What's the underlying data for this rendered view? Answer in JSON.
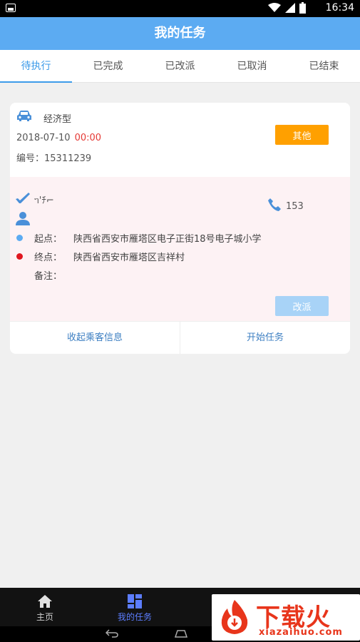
{
  "status_bar": {
    "time": "16:34"
  },
  "header": {
    "title": "我的任务"
  },
  "tabs": [
    {
      "label": "待执行",
      "active": true
    },
    {
      "label": "已完成",
      "active": false
    },
    {
      "label": "已改派",
      "active": false
    },
    {
      "label": "已取消",
      "active": false
    },
    {
      "label": "已结束",
      "active": false
    }
  ],
  "order": {
    "car_type": "经济型",
    "date": "2018-07-10",
    "time": "00:00",
    "order_no_label": "编号：",
    "order_no": "15311239",
    "other_button": "其他",
    "flight": "ᥐ'ﾁ⌐",
    "phone": "153",
    "origin_label": "起点：",
    "origin": "陕西省西安市雁塔区电子正街18号电子城小学",
    "destination_label": "终点：",
    "destination": "陕西省西安市雁塔区吉祥村",
    "remark_label": "备注：",
    "remark": "",
    "reassign_button": "改派",
    "collapse_action": "收起乘客信息",
    "start_action": "开始任务"
  },
  "bottom_nav": [
    {
      "label": "主页",
      "icon": "home-icon",
      "active": false
    },
    {
      "label": "我的任务",
      "icon": "tasks-icon",
      "active": true
    }
  ],
  "watermark": {
    "text": "下载火",
    "url": "xiazaihuo.com"
  },
  "colors": {
    "primary": "#5cabf2",
    "accent_orange": "#ffa000",
    "red": "#e53935"
  }
}
